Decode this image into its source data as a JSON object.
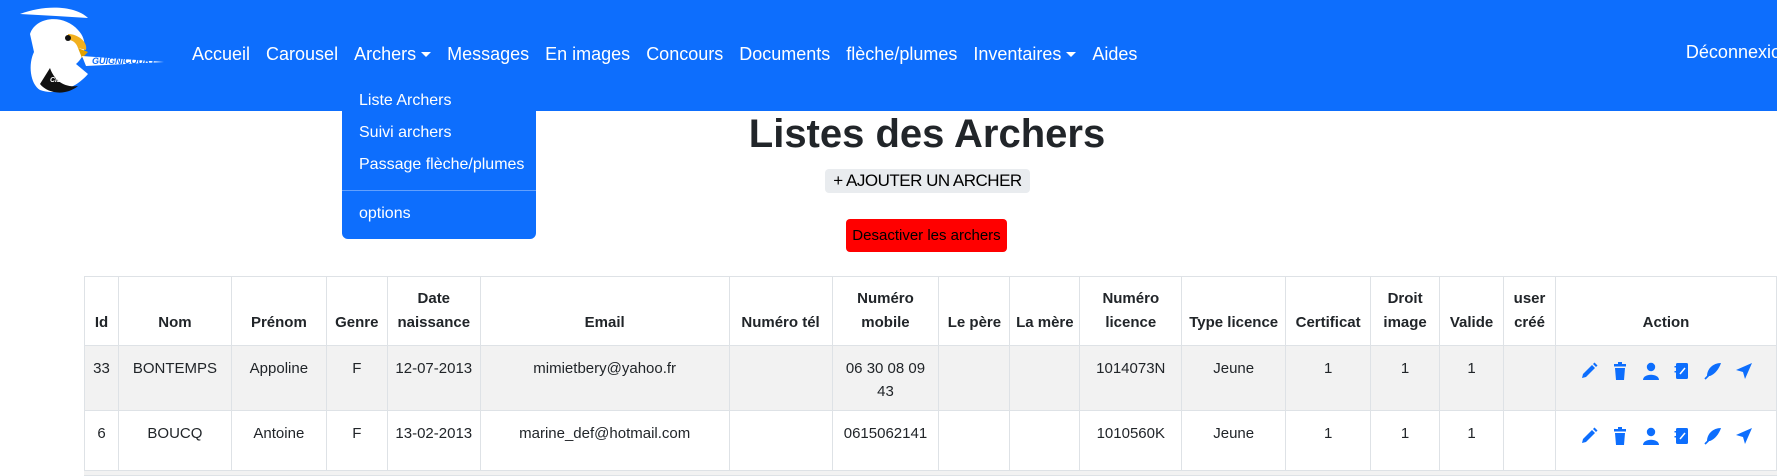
{
  "nav": {
    "logo_text": "GUIGNICOURT",
    "logo_sub": "CIE 02",
    "items": [
      {
        "label": "Accueil"
      },
      {
        "label": "Carousel"
      },
      {
        "label": "Archers"
      },
      {
        "label": "Messages"
      },
      {
        "label": "En images"
      },
      {
        "label": "Concours"
      },
      {
        "label": "Documents"
      },
      {
        "label": "flèche/plumes"
      },
      {
        "label": "Inventaires"
      },
      {
        "label": "Aides"
      }
    ],
    "logout": "Déconnexion"
  },
  "dropdown": {
    "items": [
      {
        "label": "Liste Archers"
      },
      {
        "label": "Suivi archers"
      },
      {
        "label": "Passage flèche/plumes"
      },
      {
        "label": "options"
      }
    ]
  },
  "page": {
    "title": "Listes des Archers",
    "add_button": "+ AJOUTER UN ARCHER",
    "deactivate_button": "Desactiver les archers"
  },
  "table": {
    "headers": [
      "Id",
      "Nom",
      "Prénom",
      "Genre",
      "Date naissance",
      "Email",
      "Numéro tél",
      "Numéro mobile",
      "Le père",
      "La mère",
      "Numéro licence",
      "Type licence",
      "Certificat",
      "Droit image",
      "Valide",
      "user créé",
      "Action"
    ],
    "rows": [
      {
        "id": "33",
        "nom": "BONTEMPS",
        "prenom": "Appoline",
        "genre": "F",
        "date": "12-07-2013",
        "email": "mimietbery@yahoo.fr",
        "tel": "",
        "mobile": "06 30 08 09 43",
        "pere": "",
        "mere": "",
        "licence": "1014073N",
        "type": "Jeune",
        "certificat": "1",
        "droit": "1",
        "valide": "1",
        "user": ""
      },
      {
        "id": "6",
        "nom": "BOUCQ",
        "prenom": "Antoine",
        "genre": "F",
        "date": "13-02-2013",
        "email": "marine_def@hotmail.com",
        "tel": "",
        "mobile": "0615062141",
        "pere": "",
        "mere": "",
        "licence": "1010560K",
        "type": "Jeune",
        "certificat": "1",
        "droit": "1",
        "valide": "1",
        "user": ""
      }
    ]
  },
  "colors": {
    "navbar": "#0d6efd",
    "danger": "#ff0000",
    "icon": "#0d6efd"
  },
  "action_icons": [
    "edit-pencil-icon",
    "trash-icon",
    "person-icon",
    "notebook-icon",
    "feather-icon",
    "send-arrow-icon"
  ]
}
